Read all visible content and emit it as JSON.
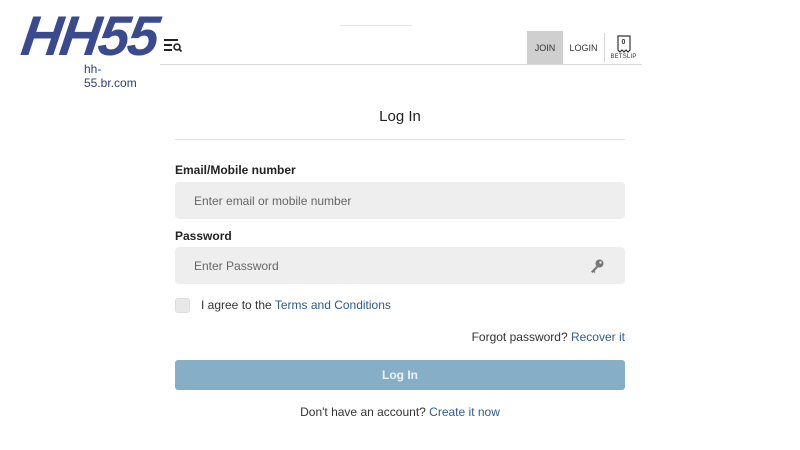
{
  "logo": {
    "text": "HH55",
    "domain": "hh-55.br.com"
  },
  "header": {
    "join_label": "JOIN",
    "login_label": "LOGIN",
    "betslip": {
      "label": "BETSLIP",
      "count": "0"
    },
    "menu_icon": "menu-search-icon"
  },
  "form": {
    "title": "Log In",
    "email": {
      "label": "Email/Mobile number",
      "placeholder": "Enter email or mobile number",
      "value": ""
    },
    "password": {
      "label": "Password",
      "placeholder": "Enter Password",
      "value": "",
      "icon": "key-icon"
    },
    "agree": {
      "prefix": "I agree to the",
      "link": "Terms and Conditions",
      "checked": false
    },
    "forgot": {
      "prefix": "Forgot password?",
      "link": "Recover it"
    },
    "submit_label": "Log In",
    "signup": {
      "prefix": "Don't have an account?",
      "link": "Create it now"
    }
  },
  "colors": {
    "brand": "#3a4a8f",
    "link": "#2e5c8a",
    "submit_bg": "#86afc7",
    "field_bg": "#eeeeee",
    "join_bg": "#cfcfcf"
  }
}
